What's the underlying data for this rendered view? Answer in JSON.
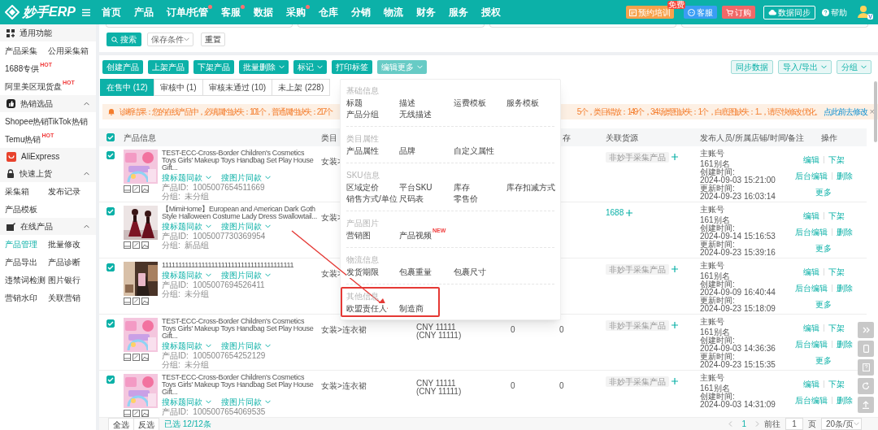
{
  "top_nav": {
    "logo": "妙手ERP",
    "items": [
      {
        "label": "首页",
        "dot": false
      },
      {
        "label": "产品",
        "dot": false
      },
      {
        "label": "订单/托管",
        "dot": true
      },
      {
        "label": "客服",
        "dot": true
      },
      {
        "label": "数据",
        "dot": false
      },
      {
        "label": "采购",
        "dot": true
      },
      {
        "label": "仓库",
        "dot": false
      },
      {
        "label": "分销",
        "dot": false
      },
      {
        "label": "物流",
        "dot": false
      },
      {
        "label": "财务",
        "dot": false
      },
      {
        "label": "服务",
        "dot": false
      },
      {
        "label": "授权",
        "dot": false
      }
    ],
    "buttons": [
      {
        "kind": "training",
        "label": "预约培训",
        "badge": "免费"
      },
      {
        "kind": "service",
        "label": "客服"
      },
      {
        "kind": "order",
        "label": "订购"
      },
      {
        "kind": "sync",
        "label": "数据同步"
      },
      {
        "kind": "help",
        "label": "帮助"
      }
    ],
    "avatar_badge": "V"
  },
  "sidebar": {
    "sections": [
      {
        "title": "通用功能",
        "items": [
          {
            "label": "产品采集",
            "selected": false
          },
          {
            "label": "公用采集箱",
            "selected": false
          },
          {
            "label": "1688专供",
            "badge": "HOT",
            "selected": false
          },
          {
            "label": "阿里美区现货盘",
            "badge": "HOT",
            "selected": false
          }
        ]
      },
      {
        "title": "热销选品",
        "expanded": true,
        "items": [
          {
            "label": "Shopee热销",
            "selected": false
          },
          {
            "label": "TikTok热销",
            "selected": false
          },
          {
            "label": "Temu热销",
            "badge": "HOT",
            "selected": false
          }
        ]
      },
      {
        "title": "AliExpress"
      },
      {
        "title": "快速上货",
        "expanded": true,
        "items": [
          {
            "label": "采集箱",
            "selected": false
          },
          {
            "label": "发布记录",
            "selected": false
          },
          {
            "label": "产品模板",
            "selected": false
          }
        ]
      },
      {
        "title": "在线产品",
        "expanded": true,
        "items": [
          {
            "label": "产品管理",
            "selected": true
          },
          {
            "label": "批量修改",
            "selected": false
          },
          {
            "label": "产品导出",
            "selected": false
          },
          {
            "label": "产品诊断",
            "selected": false
          },
          {
            "label": "违禁词检测",
            "selected": false
          },
          {
            "label": "图片银行",
            "selected": false
          },
          {
            "label": "营销水印",
            "selected": false
          },
          {
            "label": "关联营销",
            "selected": false
          }
        ]
      }
    ]
  },
  "search": {
    "search_button": "搜索",
    "saved_filter_placeholder": "保存条件",
    "reset_button": "重置"
  },
  "toolbar": {
    "actions": [
      {
        "label": "创建产品",
        "dropdown": false,
        "open": false
      },
      {
        "label": "上架产品",
        "dropdown": false,
        "open": false
      },
      {
        "label": "下架产品",
        "dropdown": false,
        "open": false
      },
      {
        "label": "批量删除",
        "dropdown": true,
        "open": false
      },
      {
        "label": "标记",
        "dropdown": true,
        "open": false
      },
      {
        "label": "打印标签",
        "dropdown": false,
        "open": false
      },
      {
        "label": "编辑更多",
        "dropdown": true,
        "open": true
      }
    ],
    "right_actions": [
      {
        "label": "同步数据",
        "dropdown": false
      },
      {
        "label": "导入/导出",
        "dropdown": true
      },
      {
        "label": "分组",
        "dropdown": true
      }
    ]
  },
  "tabs": [
    {
      "label": "在售中 (12)",
      "selected": true
    },
    {
      "label": "审核中 (1)",
      "selected": false
    },
    {
      "label": "审核未通过 (10)",
      "selected": false
    },
    {
      "label": "未上架 (228)",
      "selected": false
    }
  ],
  "warning": {
    "text_start": "诊断结果：您的在线产品中，必填属性缺失：101个，普通属性缺失：217个",
    "text_end": "5个，类目错放：149个，3:4场景图缺失：1个，白底图缺失：1...，请尽快修改优化。",
    "link": "点此前去修改",
    "close": "×"
  },
  "edit_menu": {
    "sections": [
      {
        "title": "基础信息",
        "items": [
          {
            "label": "标题"
          },
          {
            "label": "描述"
          },
          {
            "label": "运费模板"
          },
          {
            "label": "服务模板"
          },
          {
            "label": "产品分组"
          },
          {
            "label": "无线描述"
          }
        ]
      },
      {
        "title": "类目属性",
        "items": [
          {
            "label": "产品属性"
          },
          {
            "label": "品牌"
          },
          {
            "label": "自定义属性"
          }
        ]
      },
      {
        "title": "SKU信息",
        "items": [
          {
            "label": "区域定价"
          },
          {
            "label": "平台SKU"
          },
          {
            "label": "库存"
          },
          {
            "label": "库存扣减方式"
          },
          {
            "label": "销售方式/单位"
          },
          {
            "label": "尺码表"
          },
          {
            "label": "零售价"
          }
        ]
      },
      {
        "title": "产品图片",
        "items": [
          {
            "label": "营销图"
          },
          {
            "label": "产品视频",
            "badge": "NEW"
          }
        ]
      },
      {
        "title": "物流信息",
        "items": [
          {
            "label": "发货期限"
          },
          {
            "label": "包裹重量"
          },
          {
            "label": "包裹尺寸"
          }
        ]
      },
      {
        "title": "其他信息",
        "items": [
          {
            "label": "欧盟责任人"
          },
          {
            "label": "制造商"
          }
        ]
      }
    ]
  },
  "table": {
    "header_checked": true,
    "columns": [
      {
        "label": "产品信息"
      },
      {
        "label": "类目"
      },
      {},
      {},
      {
        "label": "存"
      },
      {
        "label": "关联货源"
      },
      {
        "label": "发布人员/所属店铺/时间/备注"
      },
      {
        "label": "操作"
      }
    ],
    "rows": [
      {
        "checked": true,
        "image": {
          "kind": "picture"
        },
        "title": "TEST-ECC-Cross-Border Children's Cosmetics Toys Girls' Makeup Toys Handbag Set Play House Gift...",
        "search_title": "搜标题同款",
        "search_image": "搜图片同款",
        "id_line": "产品ID:  1005007654511669",
        "group": "分组:  未分组",
        "category": "女装>",
        "source": {
          "kind": "badge",
          "label": "非妙手采集产品"
        },
        "publisher": [
          "主账号",
          "161别名",
          "创建时间:",
          "2024-09-03 15:21:00",
          "更新时间:",
          "2024-09-23 16:03:14"
        ],
        "actions": [
          [
            "编辑",
            "下架"
          ],
          [
            "后台编辑",
            "删除"
          ],
          [
            "更多"
          ]
        ]
      },
      {
        "checked": true,
        "image": {
          "kind": "picture"
        },
        "title": "【MimiHome】European and American Dark Goth Style Halloween Costume Lady Dress Swallowtail...",
        "search_title": "搜标题同款",
        "search_image": "搜图片同款",
        "id_line": "产品ID:  1005007730369954",
        "group": "分组:  新品组",
        "category": "女装>",
        "source": {
          "kind": "link",
          "label": "1688"
        },
        "publisher": [
          "主账号",
          "161别名",
          "创建时间:",
          "2024-09-14 15:16:53",
          "更新时间:",
          "2024-09-23 15:39:16"
        ],
        "actions": [
          [
            "编辑",
            "下架"
          ],
          [
            "后台编辑",
            "删除"
          ],
          [
            "更多"
          ]
        ]
      },
      {
        "checked": true,
        "image": {
          "kind": "picture"
        },
        "title": "1111111111111111111111111111111111111111",
        "search_title": "搜标题同款",
        "search_image": "搜图片同款",
        "id_line": "产品ID:  1005007694526411",
        "group": "分组:  未分组",
        "category": "女装>",
        "source": {
          "kind": "badge",
          "label": "非妙手采集产品"
        },
        "publisher": [
          "主账号",
          "161别名",
          "创建时间:",
          "2024-09-09 16:40:44",
          "更新时间:",
          "2024-09-23 15:18:09"
        ],
        "actions": [
          [
            "编辑",
            "下架"
          ],
          [
            "后台编辑",
            "删除"
          ],
          [
            "更多"
          ]
        ]
      },
      {
        "checked": true,
        "image": {
          "kind": "picture"
        },
        "title": "TEST-ECC-Cross-Border Children's Cosmetics Toys Girls' Makeup Toys Handbag Set Play House Gift...",
        "search_title": "搜标题同款",
        "search_image": "搜图片同款",
        "id_line": "产品ID:  1005007654252129",
        "group": "分组:  未分组",
        "category": "女装>连衣裙",
        "price": [
          "CNY 11111",
          "(CNY 11111)"
        ],
        "col_4": "0",
        "stock": "0",
        "source": {
          "kind": "badge",
          "label": "非妙手采集产品"
        },
        "publisher": [
          "主账号",
          "161别名",
          "创建时间:",
          "2024-09-03 14:36:36",
          "更新时间:",
          "2024-09-23 15:15:35"
        ],
        "actions": [
          [
            "编辑",
            "下架"
          ],
          [
            "后台编辑",
            "删除"
          ],
          [
            "更多"
          ]
        ]
      },
      {
        "checked": true,
        "image": {
          "kind": "picture"
        },
        "title": "TEST-ECC-Cross-Border Children's Cosmetics Toys Girls' Makeup Toys Handbag Set Play House Gift...",
        "search_title": "搜标题同款",
        "search_image": "搜图片同款",
        "id_line": "产品ID:  1005007654069535",
        "category": "女装>连衣裙",
        "price": [
          "CNY 11111",
          "(CNY 11111)"
        ],
        "col_4": "0",
        "stock": "0",
        "source": {
          "kind": "badge",
          "label": "非妙手采集产品"
        },
        "publisher": [
          "主账号",
          "161别名",
          "创建时间:",
          "2024-09-03 14:31:09"
        ],
        "actions": [
          [
            "编辑",
            "下架"
          ],
          [
            "后台编辑",
            "删除"
          ]
        ]
      }
    ]
  },
  "footer": {
    "select_all": "全选",
    "invert": "反选",
    "selected_count": "已选 12/12条",
    "pages": [
      {
        "label": "1",
        "selected": true
      }
    ],
    "goto_label": "前往",
    "page_input": "1",
    "page_unit": "页",
    "page_size": "20条/页"
  }
}
